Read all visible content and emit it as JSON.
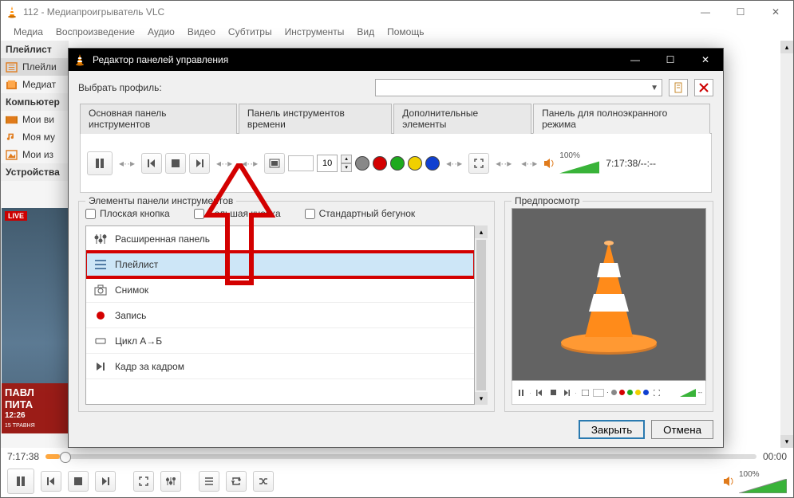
{
  "main": {
    "title": "112 - Медиапроигрыватель VLC",
    "menu": [
      "Медиа",
      "Воспроизведение",
      "Аудио",
      "Видео",
      "Субтитры",
      "Инструменты",
      "Вид",
      "Помощь"
    ],
    "time_current": "7:17:38",
    "time_total": "00:00",
    "volume_pct": "100%"
  },
  "sidebar": {
    "head_playlist": "Плейлист",
    "item_playlist": "Плейли",
    "item_media": "Медиат",
    "head_computer": "Компьютер",
    "item_my_v": "Мои ви",
    "item_my_m": "Моя му",
    "item_my_p": "Мои из",
    "head_devices": "Устройства"
  },
  "video_overlay": {
    "live": "LIVE",
    "line1": "ПАВЛ",
    "line2": "ПИТА",
    "clock": "12:26",
    "date": "15 ТРАВНЯ"
  },
  "dialog": {
    "title": "Редактор панелей управления",
    "profile_label": "Выбрать профиль:",
    "tabs": [
      "Основная панель инструментов",
      "Панель инструментов времени",
      "Дополнительные элементы",
      "Панель для полноэкранного режима"
    ],
    "active_tab": 3,
    "toolbar": {
      "spin_value": "10",
      "volume_pct": "100%",
      "time_display": "7:17:38/--:--"
    },
    "elements": {
      "group_label": "Элементы панели инструментов",
      "chk_flat": "Плоская кнопка",
      "chk_big": "Большая кнопка",
      "chk_std": "Стандартный бегунок",
      "items": [
        {
          "label": "Расширенная панель",
          "icon": "sliders"
        },
        {
          "label": "Плейлист",
          "icon": "list",
          "selected": true
        },
        {
          "label": "Снимок",
          "icon": "camera"
        },
        {
          "label": "Запись",
          "icon": "record"
        },
        {
          "label": "Цикл А→Б",
          "icon": "abloop"
        },
        {
          "label": "Кадр за кадром",
          "icon": "frame"
        }
      ]
    },
    "preview_label": "Предпросмотр",
    "btn_close": "Закрыть",
    "btn_cancel": "Отмена"
  }
}
